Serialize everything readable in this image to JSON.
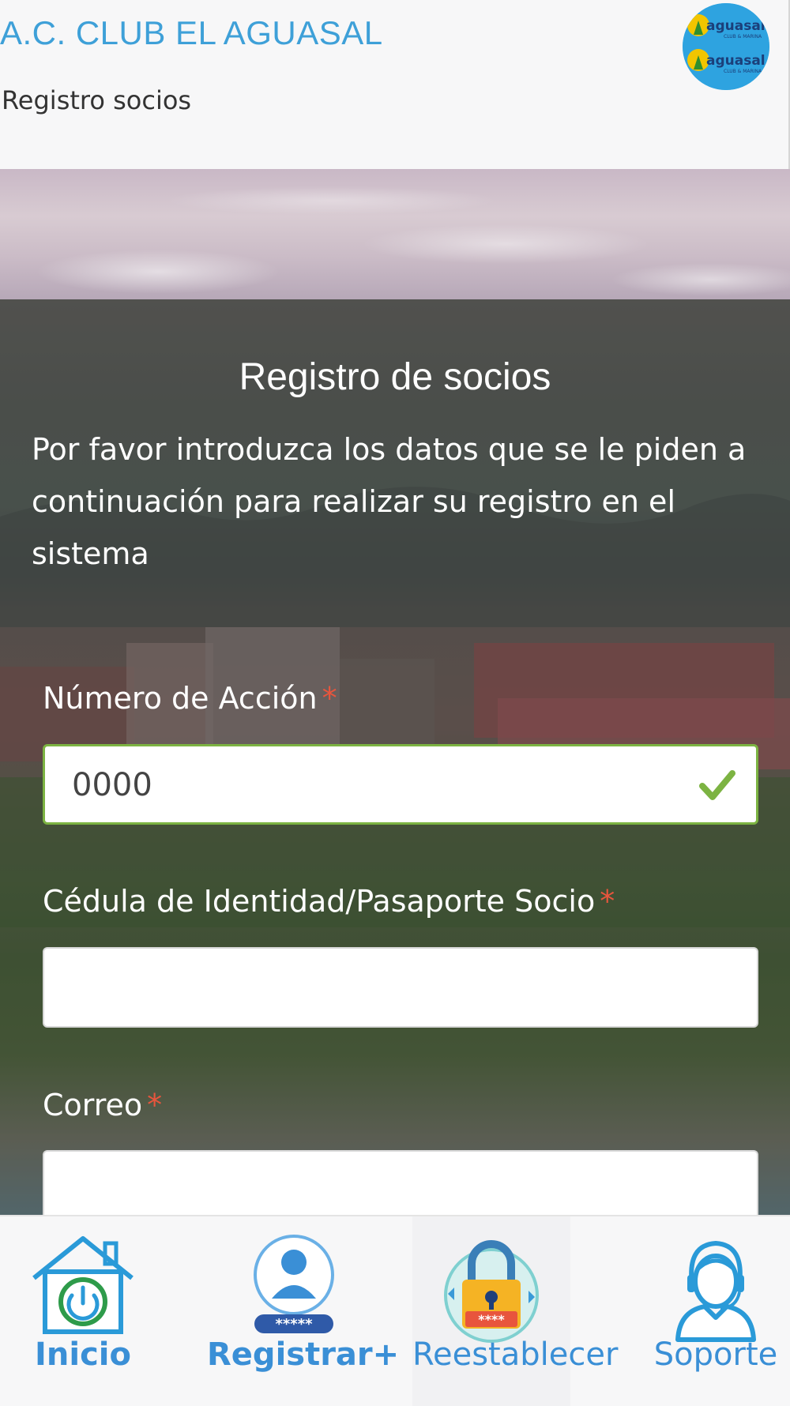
{
  "header": {
    "title": "A.C. CLUB EL AGUASAL",
    "subtitle": "Registro socios",
    "logo_text": "aguasal"
  },
  "form": {
    "title": "Registro de socios",
    "description": "Por favor introduzca los datos que se le piden a continuación para realizar su registro en el sistema",
    "required_mark": "*",
    "fields": [
      {
        "label": "Número de Acción",
        "value": "0000",
        "status": "valid"
      },
      {
        "label": "Cédula de Identidad/Pasaporte Socio",
        "value": ""
      },
      {
        "label": "Correo",
        "value": ""
      }
    ]
  },
  "nav": {
    "items": [
      {
        "label": "Inicio",
        "icon": "home-power-icon"
      },
      {
        "label": "Registrar+",
        "icon": "user-register-icon"
      },
      {
        "label": "Reestablecer",
        "icon": "padlock-reset-icon"
      },
      {
        "label": "Soporte",
        "icon": "support-agent-icon"
      }
    ]
  },
  "colors": {
    "accent": "#3ea0d8",
    "nav_label": "#3a8fd6",
    "required": "#e8553d",
    "valid": "#7cb342"
  }
}
